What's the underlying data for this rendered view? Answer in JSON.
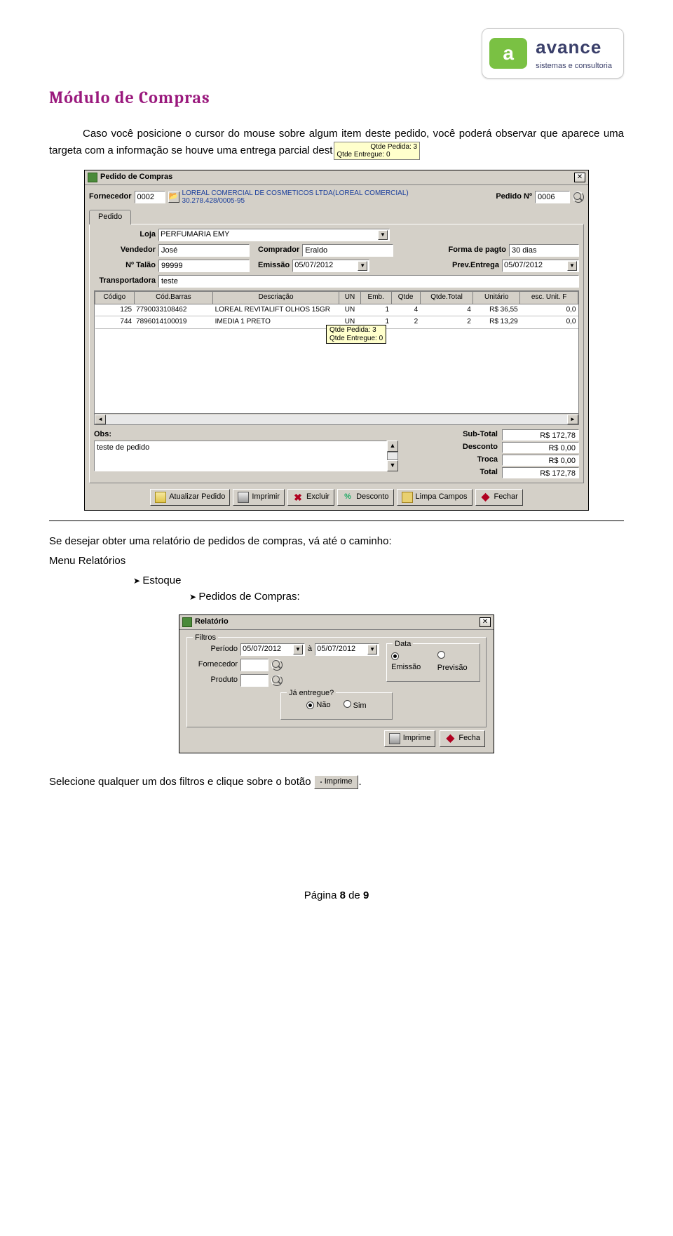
{
  "brand": {
    "name": "avance",
    "tagline": "sistemas e consultoria",
    "iconLetter": "a"
  },
  "sectionTitle": "Módulo de Compras",
  "para1": "Caso você posicione o cursor do mouse sobre algum item deste pedido, você poderá observar que aparece uma targeta com a informação se houve uma entrega parcial dest",
  "tooltipLines": {
    "a": "Qtde Pedida: 3",
    "b": "Qtde Entregue: 0"
  },
  "pedido": {
    "title": "Pedido de Compras",
    "fornecedor": {
      "label": "Fornecedor",
      "code": "0002",
      "name": "LOREAL COMERCIAL DE COSMETICOS LTDA(LOREAL COMERCIAL)",
      "cnpj": "30.278.428/0005-95"
    },
    "pedidoNo": {
      "label": "Pedido Nº",
      "value": "0006"
    },
    "tab": "Pedido",
    "loja": {
      "label": "Loja",
      "value": "PERFUMARIA EMY"
    },
    "vendedor": {
      "label": "Vendedor",
      "value": "José"
    },
    "comprador": {
      "label": "Comprador",
      "value": "Eraldo"
    },
    "formaPgto": {
      "label": "Forma de pagto",
      "value": "30 dias"
    },
    "talao": {
      "label": "Nº Talão",
      "value": "99999"
    },
    "emissao": {
      "label": "Emissão",
      "value": "05/07/2012"
    },
    "prevEntrega": {
      "label": "Prev.Entrega",
      "value": "05/07/2012"
    },
    "transportadora": {
      "label": "Transportadora",
      "value": "teste"
    },
    "gridHeaders": [
      "Código",
      "Cód.Barras",
      "Descriação",
      "UN",
      "Emb.",
      "Qtde",
      "Qtde.Total",
      "Unitário",
      "esc. Unit. F"
    ],
    "gridRows": [
      {
        "codigo": "125",
        "barras": "7790033108462",
        "desc": "LOREAL REVITALIFT OLHOS 15GR",
        "un": "UN",
        "emb": "1",
        "qtde": "4",
        "tot": "4",
        "unit": "R$ 36,55",
        "esc": "0,0"
      },
      {
        "codigo": "744",
        "barras": "7896014100019",
        "desc": "IMEDIA 1 PRETO",
        "un": "UN",
        "emb": "1",
        "qtde": "2",
        "tot": "2",
        "unit": "R$ 13,29",
        "esc": "0,0"
      }
    ],
    "obs": {
      "label": "Obs:",
      "value": "teste de pedido"
    },
    "totals": {
      "sub": {
        "label": "Sub-Total",
        "value": "R$ 172,78"
      },
      "desc": {
        "label": "Desconto",
        "value": "R$ 0,00"
      },
      "troca": {
        "label": "Troca",
        "value": "R$ 0,00"
      },
      "total": {
        "label": "Total",
        "value": "R$ 172,78"
      }
    },
    "buttons": {
      "atualizar": "Atualizar Pedido",
      "imprimir": "Imprimir",
      "excluir": "Excluir",
      "desconto": "Desconto",
      "limpa": "Limpa Campos",
      "fechar": "Fechar"
    }
  },
  "para2": "Se desejar obter uma relatório de pedidos de compras, vá até o caminho:",
  "menuPath": {
    "root": "Menu Relatórios",
    "l1": "Estoque",
    "l2": "Pedidos de Compras:"
  },
  "relatorio": {
    "title": "Relatório",
    "filtrosLabel": "Filtros",
    "periodo": {
      "label": "Período",
      "from": "05/07/2012",
      "to": "05/07/2012",
      "a": "à"
    },
    "fornecedor": {
      "label": "Fornecedor",
      "value": ""
    },
    "produto": {
      "label": "Produto",
      "value": ""
    },
    "data": {
      "label": "Data",
      "opt1": "Emissão",
      "opt2": "Previsão"
    },
    "entregue": {
      "label": "Já entregue?",
      "opt1": "Não",
      "opt2": "Sim"
    },
    "buttons": {
      "imprime": "Imprime",
      "fecha": "Fecha"
    }
  },
  "para3a": "Selecione qualquer um dos filtros e clique sobre o botão ",
  "imprimeInline": "Imprime",
  "para3b": ".",
  "footer": {
    "label": "Página ",
    "cur": "8",
    "sep": " de ",
    "total": "9"
  }
}
